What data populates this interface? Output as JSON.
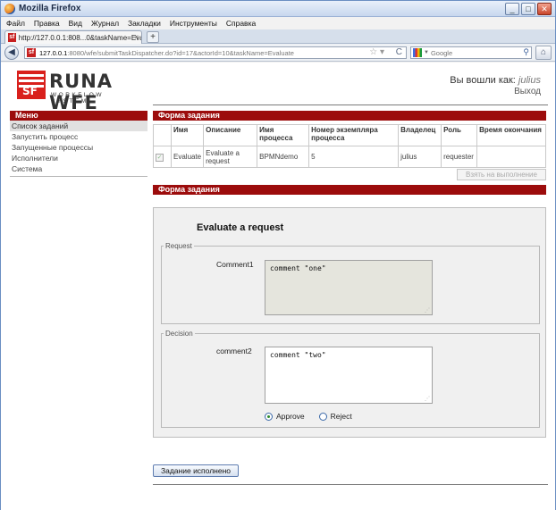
{
  "window": {
    "title": "Mozilla Firefox",
    "minimize": "_",
    "maximize": "□",
    "close": "✕"
  },
  "menu": [
    "Файл",
    "Правка",
    "Вид",
    "Журнал",
    "Закладки",
    "Инструменты",
    "Справка"
  ],
  "tab": {
    "title": "http://127.0.0.1:808...0&taskName=Evaluate",
    "close": "×",
    "new_tab": "+"
  },
  "nav": {
    "url_host": "127.0.0.1",
    "url_rest": ":8080/wfe/submitTaskDispatcher.do?id=17&actorId=10&taskName=Evaluate",
    "search_placeholder": "Google"
  },
  "header": {
    "logo_word": "RUNA WFE",
    "logo_sub": "WORKFLOW SYSTEM",
    "login_prefix": "Вы вошли как:",
    "user": "julius",
    "logout": "Выход"
  },
  "sidebar": {
    "title": "Меню",
    "items": [
      "Список заданий",
      "Запустить процесс",
      "Запущенные процессы",
      "Исполнители",
      "Система"
    ]
  },
  "task_section": {
    "title": "Форма задания",
    "columns": [
      "Имя",
      "Описание",
      "Имя процесса",
      "Номер экземпляра процесса",
      "Владелец",
      "Роль",
      "Время окончания"
    ],
    "row": {
      "name": "Evaluate",
      "description": "Evaluate a request",
      "process": "BPMNdemo",
      "instance": "5",
      "owner": "julius",
      "role": "requester",
      "end_time": ""
    },
    "take_button": "Взять на выполнение"
  },
  "form_section": {
    "title": "Форма задания",
    "form_title": "Evaluate a request",
    "request": {
      "legend": "Request",
      "label": "Comment1",
      "value": "comment \"one\""
    },
    "decision": {
      "legend": "Decision",
      "label": "comment2",
      "value": "comment \"two\"",
      "options": [
        {
          "label": "Approve",
          "selected": true
        },
        {
          "label": "Reject",
          "selected": false
        }
      ]
    },
    "submit": "Задание исполнено"
  }
}
